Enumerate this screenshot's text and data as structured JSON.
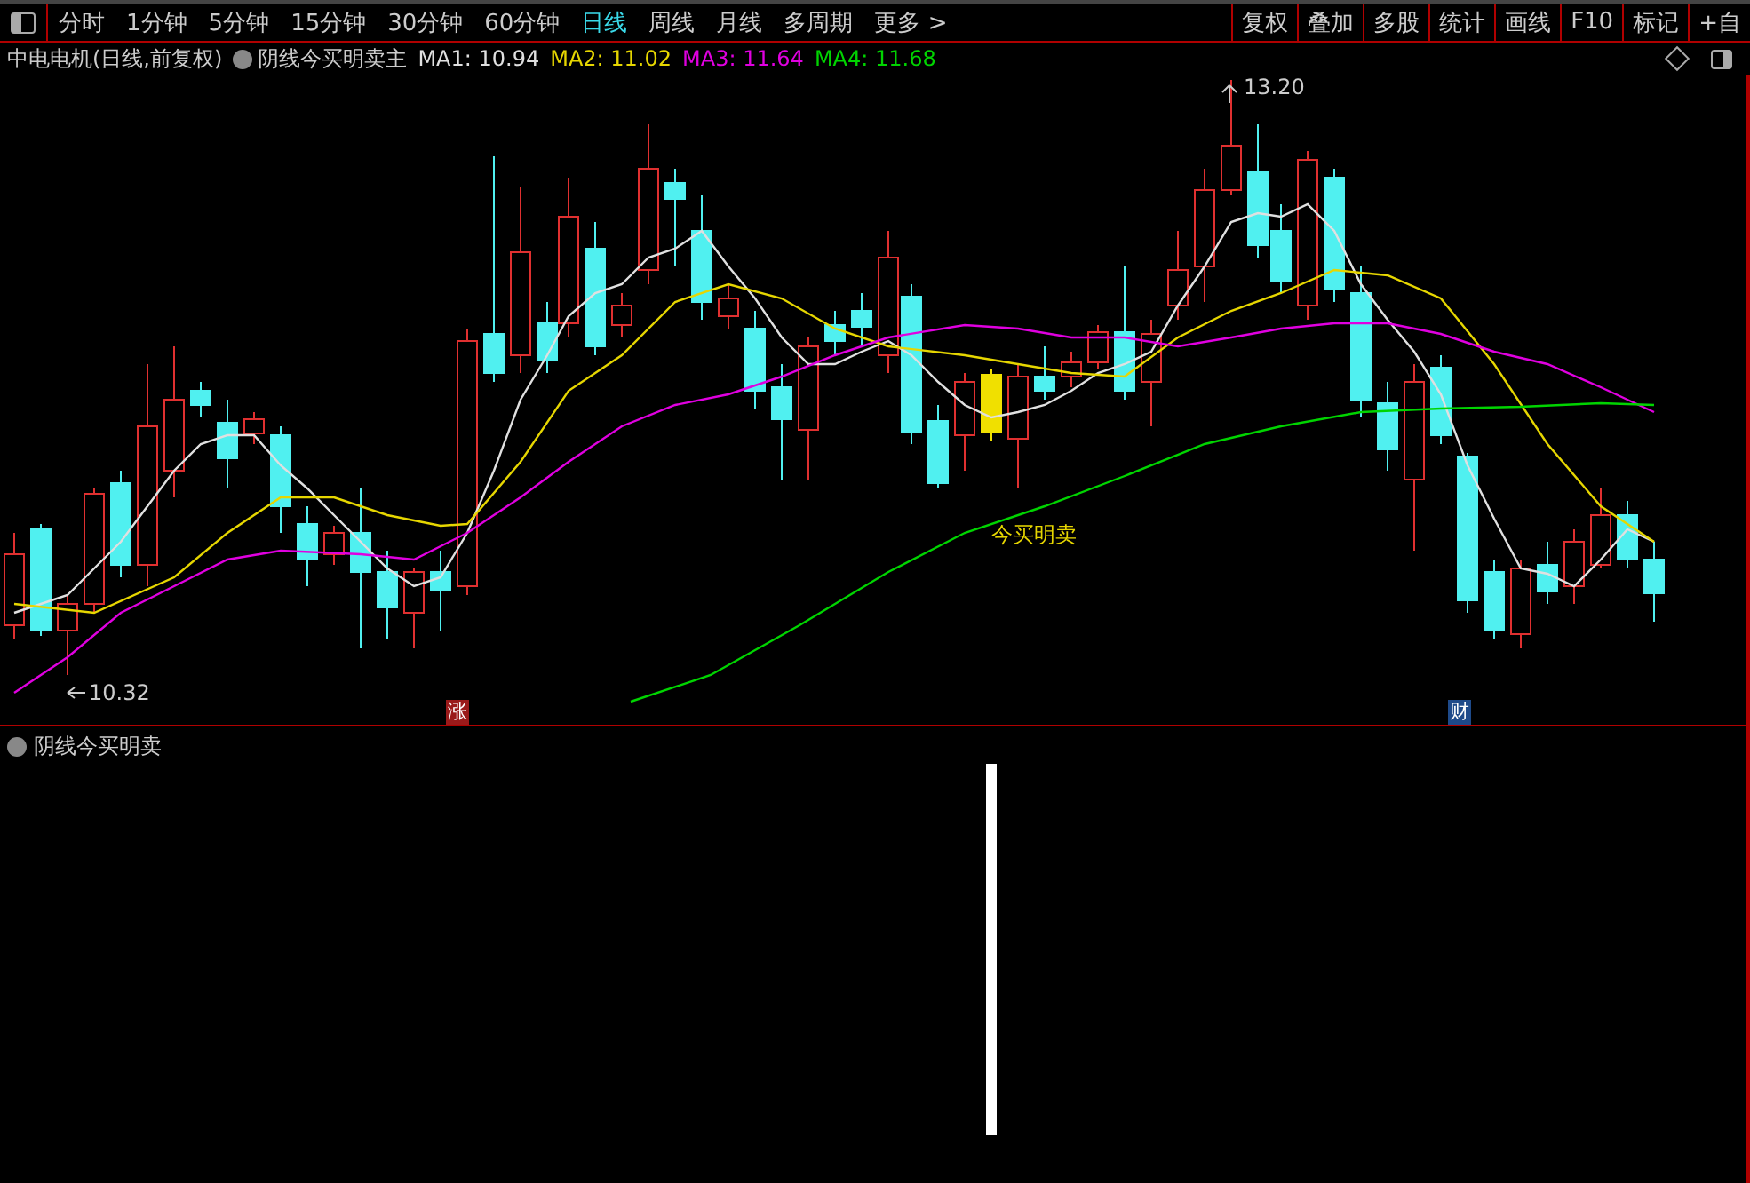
{
  "toolbar": {
    "periods": [
      {
        "label": "分时",
        "selected": false
      },
      {
        "label": "1分钟",
        "selected": false
      },
      {
        "label": "5分钟",
        "selected": false
      },
      {
        "label": "15分钟",
        "selected": false
      },
      {
        "label": "30分钟",
        "selected": false
      },
      {
        "label": "60分钟",
        "selected": false
      },
      {
        "label": "日线",
        "selected": true
      },
      {
        "label": "周线",
        "selected": false
      },
      {
        "label": "月线",
        "selected": false
      },
      {
        "label": "多周期",
        "selected": false
      }
    ],
    "more": "更多 >",
    "buttons": [
      "复权",
      "叠加",
      "多股",
      "统计",
      "画线",
      "F10",
      "标记",
      "+自"
    ]
  },
  "main_chart": {
    "title": "中电电机(日线,前复权)",
    "indicator": "阴线今买明卖主",
    "moving_averages": [
      {
        "label": "MA1: 10.94",
        "color": "#e0e0e0"
      },
      {
        "label": "MA2: 11.02",
        "color": "#e6d600"
      },
      {
        "label": "MA3: 11.64",
        "color": "#e000e0"
      },
      {
        "label": "MA4: 11.68",
        "color": "#00d400"
      }
    ],
    "high_label": "13.20",
    "low_label": "10.32",
    "signal_label": "今买明卖",
    "markers": [
      {
        "label": "涨",
        "color": "#9a1a1a"
      },
      {
        "label": "财",
        "color": "#1e4a8a"
      }
    ]
  },
  "sub_chart": {
    "title": "阴线今买明卖"
  }
}
